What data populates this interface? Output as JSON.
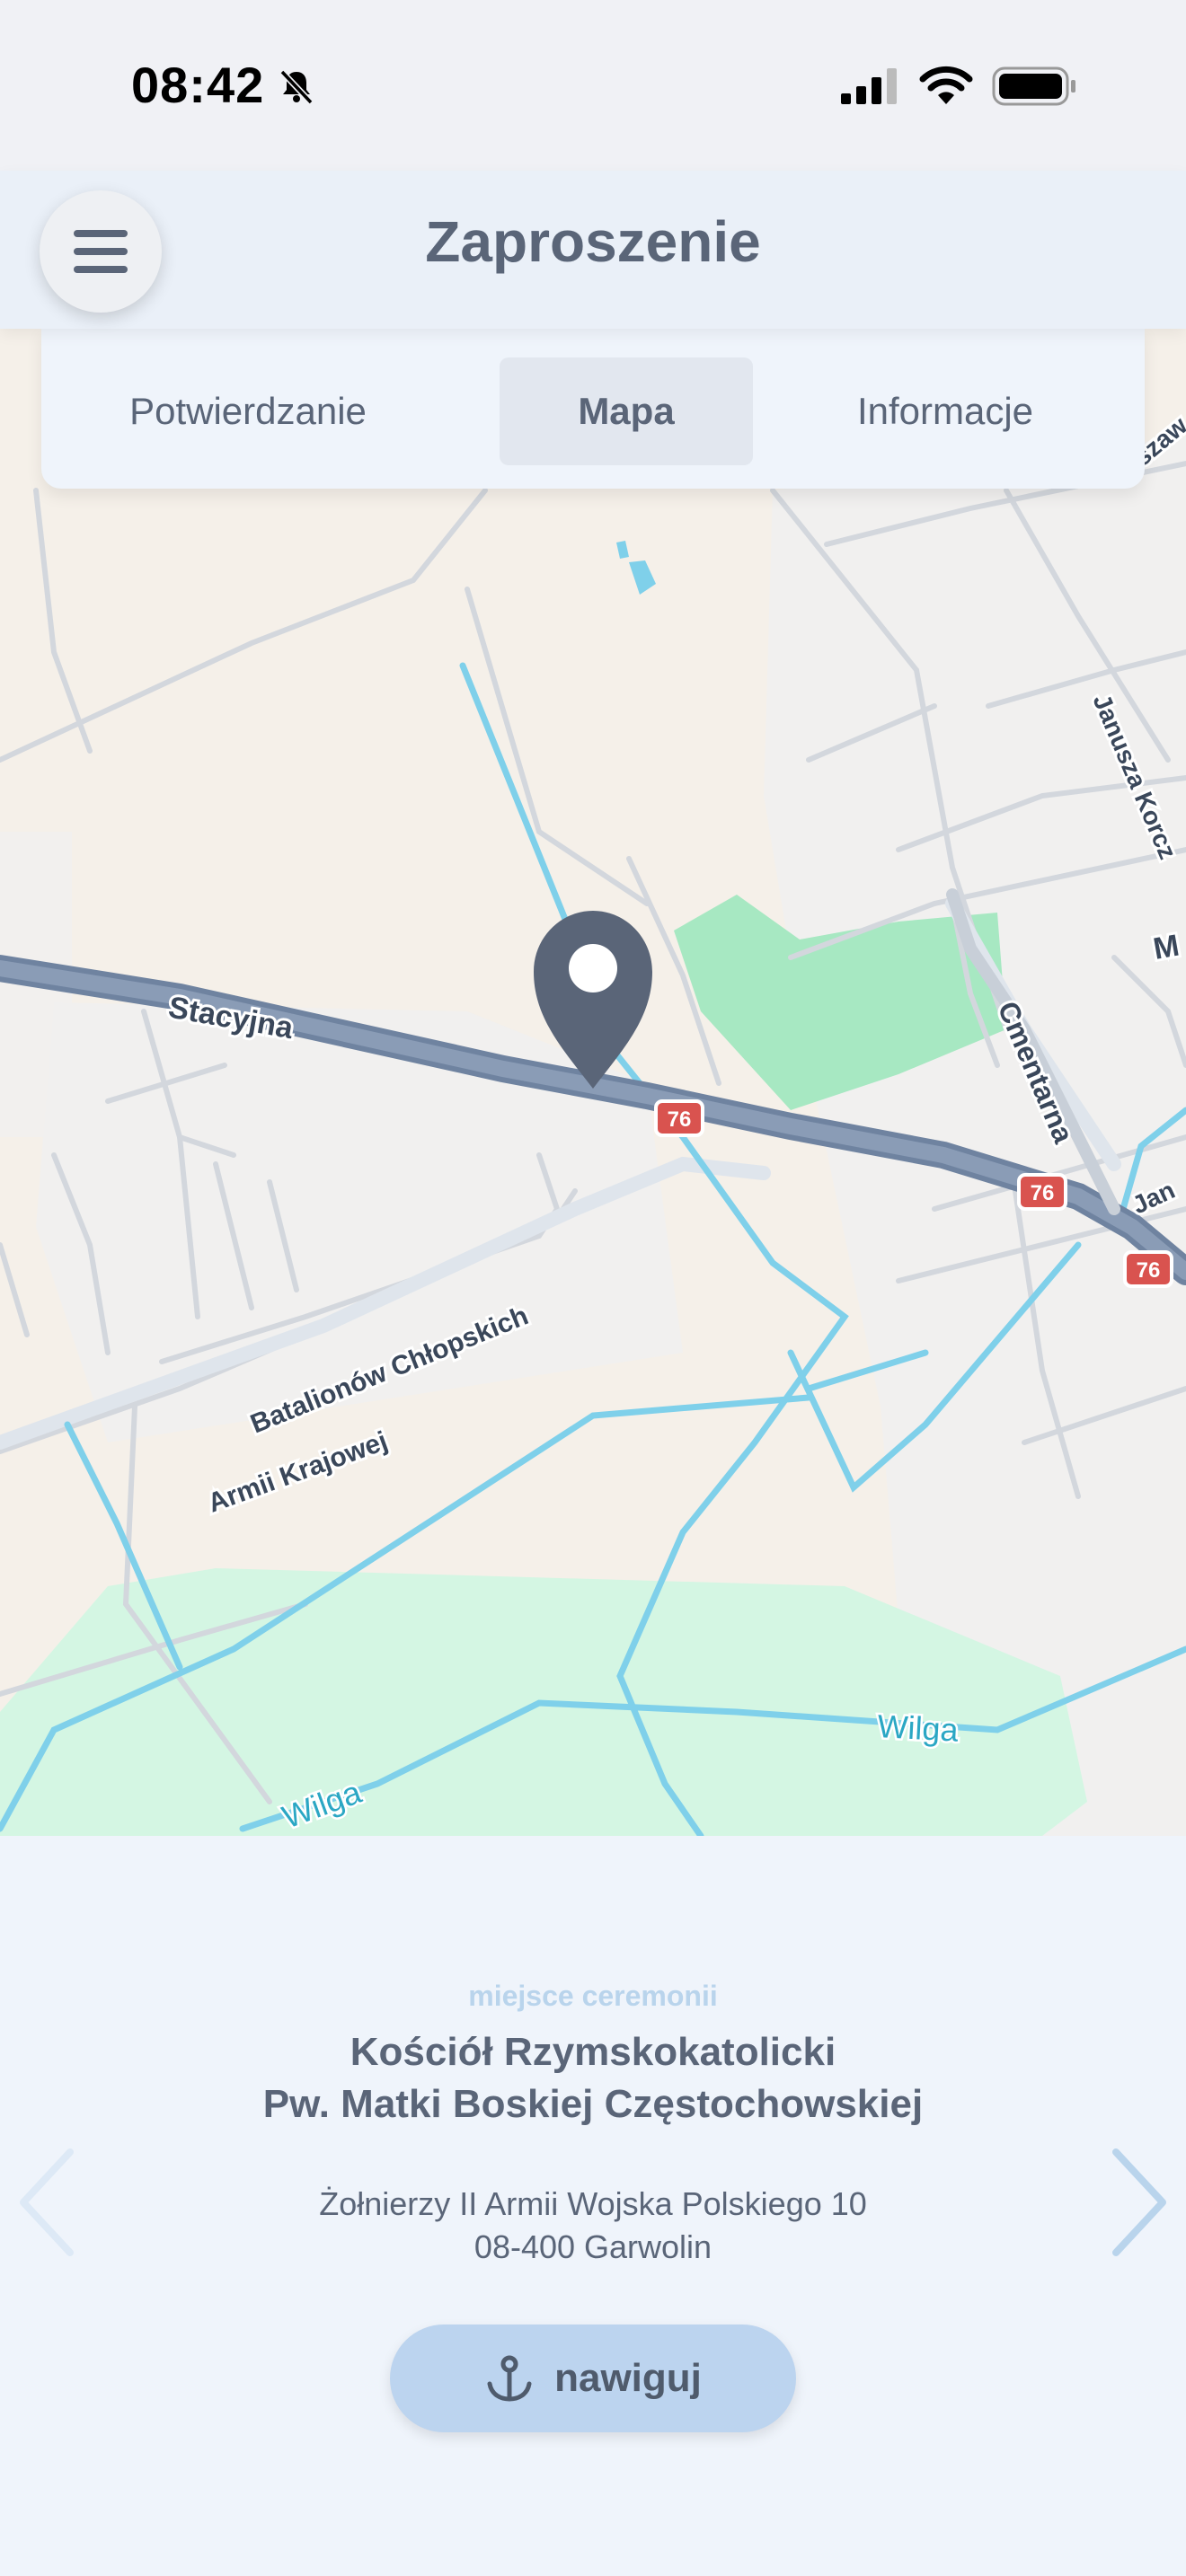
{
  "status_bar": {
    "time": "08:42"
  },
  "header": {
    "title": "Zaproszenie"
  },
  "tabs": [
    {
      "label": "Potwierdzanie",
      "active": false
    },
    {
      "label": "Mapa",
      "active": true
    },
    {
      "label": "Informacje",
      "active": false
    }
  ],
  "map": {
    "street_labels": {
      "stacyjna": "Stacyjna",
      "cmentarna": "Cmentarna",
      "batalionow": "Batalionów Chłopskich",
      "armii": "Armii Krajowej",
      "wilga_1": "Wilga",
      "wilga_2": "Wilga",
      "janusza": "Janusza Korcz",
      "jan": "Jan",
      "m": "M",
      "szaw": "szaw"
    },
    "road_badges": [
      "76",
      "76",
      "76"
    ],
    "pin_icon": "location-pin-icon"
  },
  "info": {
    "label": "miejsce ceremonii",
    "venue_line1": "Kościół Rzymskokatolicki",
    "venue_line2": "Pw. Matki Boskiej Częstochowskiej",
    "address_line1": "Żołnierzy II Armii Wojska Polskiego 10",
    "address_line2": "08-400 Garwolin",
    "navigate_label": "nawiguj"
  },
  "colors": {
    "accent": "#bcd4ef",
    "title": "#5a6578",
    "label_light": "#b9d4ec",
    "main_road": "#8194ae",
    "water": "#7fd0ea",
    "park": "#a7e8c2",
    "badge": "#d9534f"
  }
}
